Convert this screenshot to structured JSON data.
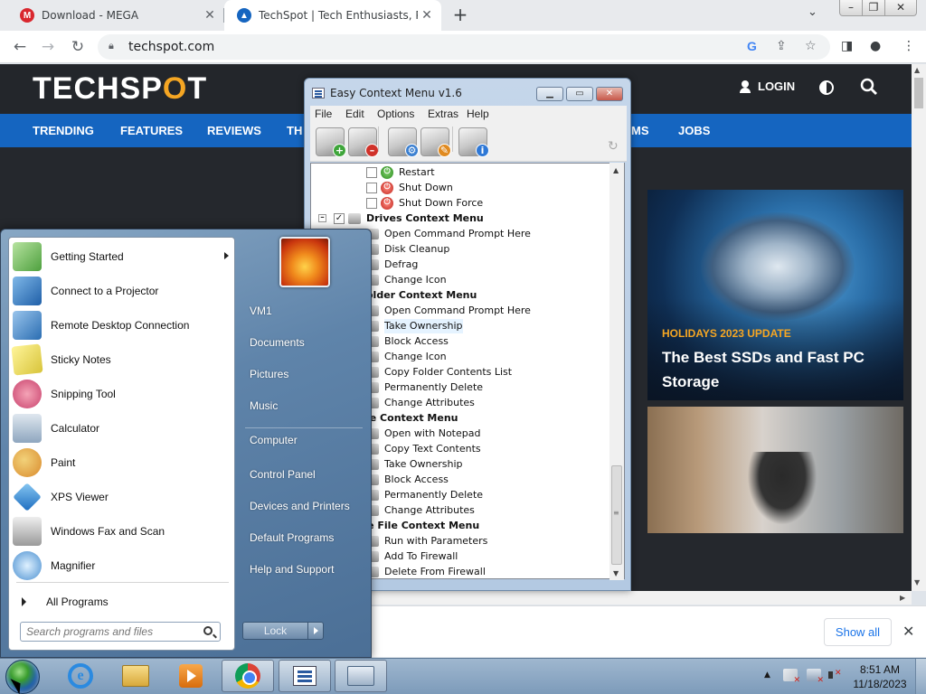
{
  "browser": {
    "tabs": [
      {
        "title": "Download - MEGA",
        "favicon": "mega-icon",
        "favicon_letter": "M",
        "favicon_color": "#d9272e"
      },
      {
        "title": "TechSpot | Tech Enthusiasts, Pow",
        "favicon": "techspot-icon",
        "favicon_letter": "▲",
        "favicon_color": "#1565c0"
      }
    ],
    "new_tab": "+",
    "url": "techspot.com"
  },
  "site": {
    "logo_text_a": "TECHSP",
    "logo_text_b": "O",
    "logo_text_c": "T",
    "login": "LOGIN",
    "nav": [
      "TRENDING",
      "FEATURES",
      "REVIEWS",
      "TH",
      "MS",
      "JOBS"
    ],
    "hero_tag": "HOLIDAYS 2023 UPDATE",
    "hero_title": "The Best SSDs and Fast PC Storage"
  },
  "downloads_bar": {
    "show_all": "Show all"
  },
  "ecm": {
    "title": "Easy Context Menu v1.6",
    "menu": [
      "File",
      "Edit",
      "Options",
      "Extras",
      "Help"
    ],
    "tree": [
      {
        "label": "Restart",
        "kind": "item",
        "icon": "restart-icon"
      },
      {
        "label": "Shut Down",
        "kind": "item",
        "icon": "shutdown-icon"
      },
      {
        "label": "Shut Down Force",
        "kind": "item",
        "icon": "shutdown-force-icon"
      },
      {
        "label": "Drives Context Menu",
        "kind": "cat",
        "checked": true
      },
      {
        "label": "Open Command Prompt Here",
        "kind": "item"
      },
      {
        "label": "Disk Cleanup",
        "kind": "item"
      },
      {
        "label": "Defrag",
        "kind": "item"
      },
      {
        "label": "Change Icon",
        "kind": "item"
      },
      {
        "label": "older Context Menu",
        "kind": "cat"
      },
      {
        "label": "Open Command Prompt Here",
        "kind": "item"
      },
      {
        "label": "Take Ownership",
        "kind": "item",
        "highlight": true
      },
      {
        "label": "Block Access",
        "kind": "item"
      },
      {
        "label": "Change Icon",
        "kind": "item"
      },
      {
        "label": "Copy Folder Contents List",
        "kind": "item"
      },
      {
        "label": "Permanently Delete",
        "kind": "item"
      },
      {
        "label": "Change Attributes",
        "kind": "item"
      },
      {
        "label": "le Context Menu",
        "kind": "cat"
      },
      {
        "label": "Open with Notepad",
        "kind": "item"
      },
      {
        "label": "Copy Text Contents",
        "kind": "item"
      },
      {
        "label": "Take Ownership",
        "kind": "item"
      },
      {
        "label": "Block Access",
        "kind": "item"
      },
      {
        "label": "Permanently Delete",
        "kind": "item"
      },
      {
        "label": "Change Attributes",
        "kind": "item"
      },
      {
        "label": "xe File Context Menu",
        "kind": "cat"
      },
      {
        "label": "Run with Parameters",
        "kind": "item"
      },
      {
        "label": "Add To Firewall",
        "kind": "item"
      },
      {
        "label": "Delete From Firewall",
        "kind": "item"
      }
    ]
  },
  "start_menu": {
    "programs": [
      {
        "label": "Getting Started",
        "icon": "getting-started-icon",
        "submenu": true
      },
      {
        "label": "Connect to a Projector",
        "icon": "projector-icon"
      },
      {
        "label": "Remote Desktop Connection",
        "icon": "remote-desktop-icon"
      },
      {
        "label": "Sticky Notes",
        "icon": "sticky-notes-icon"
      },
      {
        "label": "Snipping Tool",
        "icon": "snipping-tool-icon"
      },
      {
        "label": "Calculator",
        "icon": "calculator-icon"
      },
      {
        "label": "Paint",
        "icon": "paint-icon"
      },
      {
        "label": "XPS Viewer",
        "icon": "xps-viewer-icon"
      },
      {
        "label": "Windows Fax and Scan",
        "icon": "fax-scan-icon"
      },
      {
        "label": "Magnifier",
        "icon": "magnifier-icon"
      }
    ],
    "all_programs": "All Programs",
    "search_placeholder": "Search programs and files",
    "right_links": [
      "VM1",
      "Documents",
      "Pictures",
      "Music",
      "Computer",
      "Control Panel",
      "Devices and Printers",
      "Default Programs",
      "Help and Support"
    ],
    "lock": "Lock"
  },
  "taskbar": {
    "apps": [
      "internet-explorer-icon",
      "windows-explorer-icon",
      "media-player-icon",
      "chrome-icon",
      "easy-context-menu-icon",
      "keyboard-icon"
    ],
    "time": "8:51 AM",
    "date": "11/18/2023"
  },
  "colors": {
    "techspot_nav": "#1565c0",
    "techspot_accent": "#f5a623",
    "win7_blue": "#5f84aa"
  }
}
